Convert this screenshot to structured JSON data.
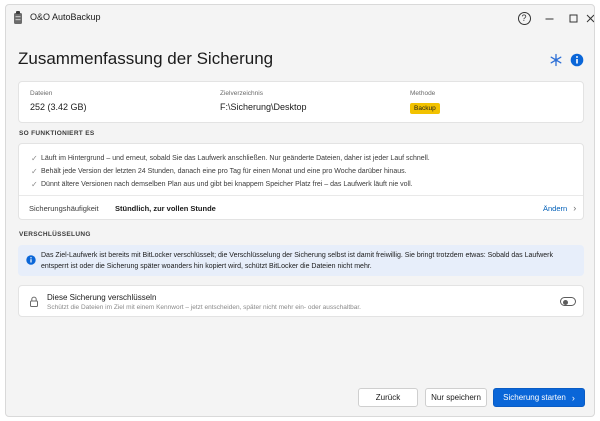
{
  "window": {
    "title": "O&O AutoBackup",
    "controls": {
      "help": "?",
      "minimize": "—",
      "maximize": "☐",
      "close": "✕"
    }
  },
  "header": {
    "title": "Zusammenfassung der Sicherung",
    "icons": [
      "snowflake-icon",
      "info-icon"
    ]
  },
  "summary": {
    "files_label": "Dateien",
    "files_value": "252 (3.42 GB)",
    "target_label": "Zielverzeichnis",
    "target_value": "F:\\Sicherung\\Desktop",
    "method_label": "Methode",
    "method_value": "Backup"
  },
  "how_it_works": {
    "heading": "SO FUNKTIONIERT ES",
    "bullets": [
      "Läuft im Hintergrund – und erneut, sobald Sie das Laufwerk anschließen. Nur geänderte Dateien, daher ist jeder Lauf schnell.",
      "Behält jede Version der letzten 24 Stunden, danach eine pro Tag für einen Monat und eine pro Woche darüber hinaus.",
      "Dünnt ältere Versionen nach demselben Plan aus und gibt bei knappem Speicher Platz frei – das Laufwerk läuft nie voll."
    ],
    "frequency_label": "Sicherungshäufigkeit",
    "frequency_value": "Stündlich, zur vollen Stunde",
    "change_label": "Ändern"
  },
  "encryption": {
    "heading": "VERSCHLÜSSELUNG",
    "info_text": "Das Ziel-Laufwerk ist bereits mit BitLocker verschlüsselt; die Verschlüsselung der Sicherung selbst ist damit freiwillig. Sie bringt trotzdem etwas: Sobald das Laufwerk entsperrt ist oder die Sicherung später woanders hin kopiert wird, schützt BitLocker die Dateien nicht mehr.",
    "toggle_title": "Diese Sicherung verschlüsseln",
    "toggle_subtitle": "Schützt die Dateien im Ziel mit einem Kennwort – jetzt entscheiden, später nicht mehr ein- oder ausschaltbar.",
    "toggle_on": false
  },
  "footer": {
    "back_label": "Zurück",
    "save_label": "Nur speichern",
    "start_label": "Sicherung starten"
  },
  "colors": {
    "accent": "#0a66d8",
    "badge": "#f2c200",
    "info_bg": "#e7eefa",
    "window_bg": "#f4f4f4"
  }
}
